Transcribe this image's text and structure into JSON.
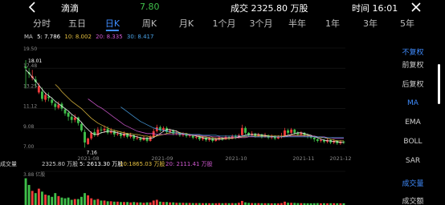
{
  "header": {
    "stock_name": "滴滴",
    "last_price": "7.80",
    "volume_text": "成交 2325.80 万股",
    "time_text": "时间 16:01"
  },
  "tabs": [
    "分时",
    "五日",
    "日K",
    "周K",
    "月K",
    "1个月",
    "3个月",
    "半年",
    "1年",
    "3年",
    "5年"
  ],
  "active_tab": "日K",
  "ma": {
    "label": "MA",
    "ma5": "5: 7.786",
    "ma10": "10: 8.002",
    "ma20": "20: 8.335",
    "ma30": "30: 8.417"
  },
  "colors": {
    "up": "#ef3b3b",
    "down": "#3fbf4a",
    "accent": "#3f8cff",
    "ma5": "#ffffff",
    "ma10": "#e5c040",
    "ma20": "#d35ad3",
    "ma30": "#4aa3e8"
  },
  "price_axis": {
    "labels": [
      "19.50",
      "17.48",
      "13.25",
      "11.12",
      "9.08",
      "7.00"
    ]
  },
  "high_marker": "18.01",
  "low_marker": "7.16",
  "date_axis": [
    "2021-08",
    "2021-09",
    "2021-10",
    "2021-11",
    "2021-12"
  ],
  "volume_panel": {
    "title": "成交量",
    "total": "2325.80 万股",
    "ma5": "5: 2613.30 万股",
    "ma10": "10:1865.03 万股",
    "ma20": "20: 2111.41 万股",
    "axis_top": "3.88 亿股"
  },
  "sidebar": {
    "items": [
      "不复权",
      "前复权",
      "后复权",
      "MA",
      "EMA",
      "BOLL",
      "SAR",
      "成交量",
      "成交额"
    ],
    "active": [
      "不复权",
      "MA",
      "成交量"
    ]
  },
  "chart_data": {
    "type": "candlestick",
    "title": "",
    "x_ticks": [
      "2021-08",
      "2021-09",
      "2021-10",
      "2021-11",
      "2021-12"
    ],
    "ylim": [
      7.0,
      19.5
    ],
    "candles": [
      [
        17.2,
        17.0,
        18.01,
        14.5
      ],
      [
        16.5,
        16.3,
        17.0,
        15.8
      ],
      [
        15.8,
        16.0,
        16.8,
        15.5
      ],
      [
        15.6,
        15.3,
        16.0,
        14.6
      ],
      [
        14.0,
        14.8,
        15.2,
        13.8
      ],
      [
        14.1,
        13.2,
        14.6,
        12.9
      ],
      [
        13.1,
        13.7,
        14.0,
        12.8
      ],
      [
        13.5,
        13.3,
        14.0,
        12.9
      ],
      [
        13.1,
        12.7,
        13.4,
        12.4
      ],
      [
        12.6,
        12.2,
        12.8,
        11.8
      ],
      [
        12.1,
        12.5,
        12.9,
        11.9
      ],
      [
        12.6,
        12.0,
        12.8,
        11.7
      ],
      [
        11.9,
        11.4,
        12.1,
        11.1
      ],
      [
        11.5,
        11.0,
        11.6,
        10.5
      ],
      [
        11.0,
        10.6,
        11.3,
        10.2
      ],
      [
        10.6,
        10.9,
        11.3,
        10.3
      ],
      [
        10.9,
        10.2,
        11.0,
        9.9
      ],
      [
        10.1,
        9.3,
        10.3,
        9.1
      ],
      [
        9.1,
        7.8,
        9.4,
        7.16
      ],
      [
        7.6,
        8.3,
        8.4,
        7.5
      ],
      [
        8.3,
        9.0,
        9.2,
        8.1
      ],
      [
        9.1,
        8.7,
        9.5,
        8.5
      ],
      [
        8.7,
        9.4,
        9.7,
        8.5
      ],
      [
        9.4,
        9.3,
        9.8,
        8.9
      ],
      [
        9.3,
        9.5,
        9.9,
        9.0
      ],
      [
        9.5,
        9.0,
        9.8,
        8.8
      ],
      [
        9.0,
        9.2,
        9.6,
        8.8
      ],
      [
        9.2,
        8.8,
        9.4,
        8.5
      ],
      [
        8.8,
        8.9,
        9.2,
        8.6
      ],
      [
        8.9,
        8.6,
        9.1,
        8.3
      ],
      [
        8.6,
        8.9,
        9.2,
        8.4
      ],
      [
        8.9,
        8.5,
        9.0,
        8.3
      ],
      [
        8.5,
        8.7,
        9.0,
        8.3
      ],
      [
        8.7,
        8.3,
        8.8,
        8.0
      ],
      [
        8.3,
        8.4,
        8.7,
        8.1
      ],
      [
        8.4,
        8.1,
        8.5,
        7.9
      ],
      [
        8.1,
        8.4,
        8.6,
        8.0
      ],
      [
        8.4,
        8.0,
        8.5,
        7.8
      ],
      [
        8.0,
        8.5,
        8.7,
        7.9
      ],
      [
        8.5,
        9.2,
        9.5,
        8.4
      ],
      [
        9.2,
        9.7,
        10.0,
        9.0
      ],
      [
        9.7,
        9.3,
        9.9,
        9.1
      ],
      [
        9.3,
        9.6,
        9.8,
        9.1
      ],
      [
        9.6,
        9.1,
        9.8,
        8.9
      ],
      [
        9.1,
        9.3,
        9.5,
        8.9
      ],
      [
        9.3,
        8.9,
        9.4,
        8.7
      ],
      [
        8.9,
        9.0,
        9.3,
        8.7
      ],
      [
        9.0,
        8.7,
        9.1,
        8.5
      ],
      [
        8.7,
        8.9,
        9.1,
        8.5
      ],
      [
        8.9,
        8.6,
        9.0,
        8.4
      ],
      [
        8.6,
        8.7,
        8.9,
        8.4
      ],
      [
        8.7,
        8.4,
        8.8,
        8.2
      ],
      [
        8.4,
        8.5,
        8.7,
        8.2
      ],
      [
        8.5,
        8.2,
        8.6,
        8.0
      ],
      [
        8.2,
        8.4,
        8.6,
        8.0
      ],
      [
        8.4,
        8.1,
        8.5,
        7.9
      ],
      [
        8.1,
        8.3,
        8.5,
        7.9
      ],
      [
        8.3,
        8.0,
        8.4,
        7.8
      ],
      [
        8.0,
        8.2,
        8.4,
        7.9
      ],
      [
        8.2,
        8.4,
        8.6,
        8.0
      ],
      [
        8.4,
        8.2,
        8.5,
        8.0
      ],
      [
        8.2,
        8.5,
        8.7,
        8.1
      ],
      [
        8.5,
        8.3,
        8.6,
        8.1
      ],
      [
        8.3,
        8.6,
        8.8,
        8.2
      ],
      [
        8.6,
        8.4,
        8.8,
        8.2
      ],
      [
        8.4,
        8.7,
        8.9,
        8.3
      ],
      [
        8.7,
        9.6,
        10.0,
        8.6
      ],
      [
        9.6,
        9.0,
        9.8,
        8.8
      ],
      [
        9.0,
        8.7,
        9.1,
        8.5
      ],
      [
        8.7,
        8.9,
        9.2,
        8.5
      ],
      [
        8.9,
        8.6,
        9.0,
        8.4
      ],
      [
        8.6,
        8.8,
        9.0,
        8.5
      ],
      [
        8.8,
        8.5,
        8.9,
        8.3
      ],
      [
        8.5,
        8.7,
        9.0,
        8.4
      ],
      [
        8.7,
        8.4,
        8.8,
        8.2
      ],
      [
        8.4,
        8.6,
        8.8,
        8.2
      ],
      [
        8.6,
        8.3,
        8.7,
        8.1
      ],
      [
        8.3,
        8.5,
        8.7,
        8.2
      ],
      [
        8.5,
        8.6,
        9.0,
        8.3
      ],
      [
        8.6,
        9.3,
        9.6,
        8.5
      ],
      [
        9.3,
        9.0,
        9.5,
        8.8
      ],
      [
        9.0,
        9.4,
        9.6,
        8.8
      ],
      [
        9.4,
        9.0,
        9.5,
        8.8
      ],
      [
        9.0,
        8.8,
        9.2,
        8.6
      ],
      [
        8.8,
        9.0,
        9.2,
        8.6
      ],
      [
        9.0,
        8.7,
        9.1,
        8.5
      ],
      [
        8.7,
        8.6,
        8.9,
        8.3
      ],
      [
        8.6,
        8.4,
        8.7,
        8.2
      ],
      [
        8.4,
        8.2,
        8.5,
        7.9
      ],
      [
        8.2,
        8.0,
        8.3,
        7.8
      ],
      [
        8.0,
        8.1,
        8.3,
        7.8
      ],
      [
        8.1,
        7.9,
        8.2,
        7.7
      ],
      [
        7.9,
        8.1,
        8.3,
        7.7
      ],
      [
        8.1,
        7.8,
        8.2,
        7.6
      ],
      [
        7.8,
        8.0,
        8.2,
        7.6
      ],
      [
        8.0,
        7.7,
        8.1,
        7.5
      ],
      [
        7.7,
        7.9,
        8.1,
        7.5
      ],
      [
        7.9,
        7.8,
        8.0,
        7.6
      ]
    ],
    "ma": {
      "ma5": [
        16.8,
        16.4,
        15.9,
        15.4,
        14.9,
        14.4,
        13.9,
        13.6,
        13.3,
        12.9,
        12.6,
        12.3,
        12.0,
        11.7,
        11.3,
        11.0,
        10.7,
        10.3,
        9.8,
        9.4,
        9.0,
        8.8,
        8.8,
        9.0,
        9.1,
        9.2,
        9.2,
        9.1,
        9.0,
        8.9,
        8.8,
        8.8,
        8.7,
        8.6,
        8.5,
        8.4,
        8.3,
        8.3,
        8.3,
        8.4,
        8.7,
        8.9,
        9.2,
        9.4,
        9.4,
        9.3,
        9.2,
        9.0,
        8.9,
        8.8,
        8.8,
        8.7,
        8.6,
        8.5,
        8.4,
        8.3,
        8.3,
        8.2,
        8.2,
        8.2,
        8.2,
        8.3,
        8.3,
        8.4,
        8.4,
        8.5,
        8.6,
        8.7,
        8.8,
        8.8,
        8.8,
        8.8,
        8.7,
        8.7,
        8.6,
        8.6,
        8.5,
        8.5,
        8.5,
        8.6,
        8.7,
        8.8,
        8.9,
        9.0,
        9.0,
        8.9,
        8.8,
        8.7,
        8.5,
        8.4,
        8.2,
        8.1,
        8.0,
        8.0,
        7.9,
        7.9,
        7.8,
        7.8
      ],
      "ma10": [
        null,
        null,
        null,
        null,
        null,
        null,
        null,
        null,
        null,
        15.0,
        14.6,
        14.1,
        13.7,
        13.3,
        12.9,
        12.6,
        12.3,
        12.0,
        11.6,
        11.2,
        10.8,
        10.5,
        10.2,
        10.0,
        9.8,
        9.6,
        9.4,
        9.3,
        9.2,
        9.1,
        9.0,
        8.9,
        8.9,
        8.8,
        8.8,
        8.7,
        8.6,
        8.6,
        8.5,
        8.5,
        8.6,
        8.7,
        8.8,
        8.9,
        9.0,
        9.0,
        9.0,
        9.0,
        8.9,
        8.9,
        8.8,
        8.7,
        8.7,
        8.6,
        8.5,
        8.5,
        8.4,
        8.4,
        8.3,
        8.3,
        8.3,
        8.3,
        8.3,
        8.3,
        8.4,
        8.4,
        8.5,
        8.5,
        8.6,
        8.6,
        8.6,
        8.6,
        8.6,
        8.6,
        8.6,
        8.6,
        8.6,
        8.6,
        8.6,
        8.6,
        8.6,
        8.7,
        8.7,
        8.7,
        8.7,
        8.7,
        8.7,
        8.6,
        8.6,
        8.5,
        8.4,
        8.4,
        8.3,
        8.2,
        8.1,
        8.0,
        8.0,
        8.0
      ],
      "ma20": [
        null,
        null,
        null,
        null,
        null,
        null,
        null,
        null,
        null,
        null,
        null,
        null,
        null,
        null,
        null,
        null,
        null,
        null,
        null,
        13.2,
        12.9,
        12.6,
        12.3,
        12.1,
        11.8,
        11.5,
        11.2,
        10.9,
        10.6,
        10.3,
        10.0,
        9.8,
        9.6,
        9.4,
        9.2,
        9.1,
        9.0,
        8.9,
        8.9,
        8.9,
        8.8,
        8.8,
        8.8,
        8.8,
        8.8,
        8.8,
        8.8,
        8.8,
        8.8,
        8.8,
        8.7,
        8.7,
        8.7,
        8.7,
        8.6,
        8.6,
        8.6,
        8.5,
        8.5,
        8.5,
        8.4,
        8.4,
        8.4,
        8.4,
        8.4,
        8.4,
        8.4,
        8.4,
        8.5,
        8.5,
        8.5,
        8.5,
        8.5,
        8.5,
        8.5,
        8.5,
        8.5,
        8.5,
        8.5,
        8.5,
        8.6,
        8.6,
        8.6,
        8.6,
        8.6,
        8.6,
        8.6,
        8.6,
        8.6,
        8.5,
        8.5,
        8.5,
        8.4,
        8.4,
        8.3,
        8.3,
        8.3,
        8.3
      ],
      "ma30": [
        null,
        null,
        null,
        null,
        null,
        null,
        null,
        null,
        null,
        null,
        null,
        null,
        null,
        null,
        null,
        null,
        null,
        null,
        null,
        null,
        null,
        null,
        null,
        null,
        null,
        null,
        null,
        null,
        null,
        12.2,
        11.9,
        11.6,
        11.3,
        11.0,
        10.7,
        10.4,
        10.2,
        10.0,
        9.8,
        9.6,
        9.5,
        9.4,
        9.3,
        9.2,
        9.1,
        9.0,
        9.0,
        8.9,
        8.9,
        8.8,
        8.8,
        8.8,
        8.8,
        8.8,
        8.7,
        8.7,
        8.7,
        8.7,
        8.7,
        8.6,
        8.6,
        8.6,
        8.6,
        8.6,
        8.6,
        8.6,
        8.6,
        8.6,
        8.6,
        8.6,
        8.5,
        8.5,
        8.5,
        8.5,
        8.5,
        8.5,
        8.5,
        8.5,
        8.5,
        8.5,
        8.5,
        8.5,
        8.5,
        8.5,
        8.5,
        8.5,
        8.5,
        8.5,
        8.5,
        8.5,
        8.5,
        8.4,
        8.4,
        8.4,
        8.4,
        8.4,
        8.4,
        8.4
      ]
    },
    "volume_ylim": [
      0,
      3.88
    ],
    "volumes": [
      3.6,
      2.7,
      1.9,
      1.6,
      2.2,
      1.8,
      1.4,
      1.3,
      1.1,
      1.6,
      1.2,
      1.0,
      0.9,
      1.0,
      0.7,
      0.8,
      0.8,
      1.1,
      1.6,
      1.3,
      0.9,
      0.7,
      0.8,
      0.6,
      0.6,
      0.5,
      0.5,
      0.45,
      0.45,
      0.4,
      0.4,
      0.4,
      0.35,
      0.4,
      0.35,
      0.35,
      0.3,
      0.35,
      0.35,
      0.6,
      0.7,
      0.45,
      0.4,
      0.4,
      0.35,
      0.35,
      0.3,
      0.3,
      0.3,
      0.28,
      0.28,
      0.26,
      0.26,
      0.26,
      0.25,
      0.25,
      0.24,
      0.24,
      0.24,
      0.26,
      0.24,
      0.26,
      0.24,
      0.26,
      0.24,
      0.3,
      0.55,
      0.35,
      0.28,
      0.26,
      0.25,
      0.25,
      0.24,
      0.24,
      0.23,
      0.23,
      0.23,
      0.22,
      0.26,
      0.45,
      0.3,
      0.3,
      0.28,
      0.25,
      0.25,
      0.24,
      0.23,
      0.23,
      0.24,
      0.25,
      0.23,
      0.24,
      0.23,
      0.24,
      0.24,
      0.23,
      0.23,
      0.23
    ]
  }
}
